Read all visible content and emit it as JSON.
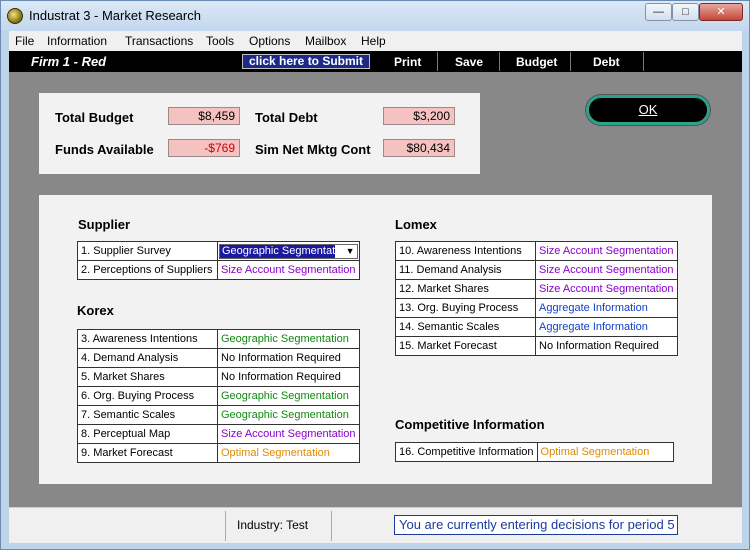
{
  "window": {
    "title": "Industrat 3 - Market Research"
  },
  "menu": [
    "File",
    "Information",
    "Transactions",
    "Tools",
    "Options",
    "Mailbox",
    "Help"
  ],
  "toolbar": {
    "firm": "Firm 1 - Red",
    "submit": "click here to Submit",
    "print": "Print",
    "save": "Save",
    "budget": "Budget",
    "debt": "Debt"
  },
  "summary": {
    "total_budget_label": "Total Budget",
    "total_budget": "$8,459",
    "funds_label": "Funds Available",
    "funds": "-$769",
    "total_debt_label": "Total Debt",
    "total_debt": "$3,200",
    "sim_label": "Sim Net Mktg Cont",
    "sim": "$80,434"
  },
  "ok_label": "OK",
  "supplier": {
    "title": "Supplier",
    "rows": [
      {
        "num": "1.",
        "name": "Supplier Survey",
        "value": "Geographic Segmentation",
        "color": "dropdown"
      },
      {
        "num": "2.",
        "name": "Perceptions of Suppliers",
        "value": "Size Account Segmentation",
        "color": "purple"
      }
    ]
  },
  "korex": {
    "title": "Korex",
    "rows": [
      {
        "num": "3.",
        "name": "Awareness Intentions",
        "value": "Geographic Segmentation",
        "color": "green"
      },
      {
        "num": "4.",
        "name": "Demand Analysis",
        "value": "No Information Required",
        "color": "black"
      },
      {
        "num": "5.",
        "name": "Market Shares",
        "value": "No Information Required",
        "color": "black"
      },
      {
        "num": "6.",
        "name": "Org. Buying Process",
        "value": "Geographic Segmentation",
        "color": "green"
      },
      {
        "num": "7.",
        "name": "Semantic Scales",
        "value": "Geographic Segmentation",
        "color": "green"
      },
      {
        "num": "8.",
        "name": "Perceptual Map",
        "value": "Size Account Segmentation",
        "color": "purple"
      },
      {
        "num": "9.",
        "name": "Market Forecast",
        "value": "Optimal Segmentation",
        "color": "orange"
      }
    ]
  },
  "lomex": {
    "title": "Lomex",
    "rows": [
      {
        "num": "10.",
        "name": "Awareness Intentions",
        "value": "Size Account Segmentation",
        "color": "purple"
      },
      {
        "num": "11.",
        "name": "Demand Analysis",
        "value": "Size Account Segmentation",
        "color": "purple"
      },
      {
        "num": "12.",
        "name": "Market Shares",
        "value": "Size Account Segmentation",
        "color": "purple"
      },
      {
        "num": "13.",
        "name": "Org. Buying Process",
        "value": "Aggregate Information",
        "color": "blue"
      },
      {
        "num": "14.",
        "name": "Semantic Scales",
        "value": "Aggregate Information",
        "color": "blue"
      },
      {
        "num": "15.",
        "name": "Market Forecast",
        "value": "No Information Required",
        "color": "black"
      }
    ]
  },
  "competitive": {
    "title": "Competitive Information",
    "rows": [
      {
        "num": "16.",
        "name": "Competitive Information",
        "value": "Optimal Segmentation",
        "color": "orange"
      }
    ]
  },
  "status": {
    "industry": "Industry: Test",
    "period": "You are currently entering decisions for period 5"
  },
  "colors": {
    "green": "#0f8a0f",
    "purple": "#8800cc",
    "orange": "#e08a00",
    "blue": "#1240c8",
    "black": "#000000"
  }
}
